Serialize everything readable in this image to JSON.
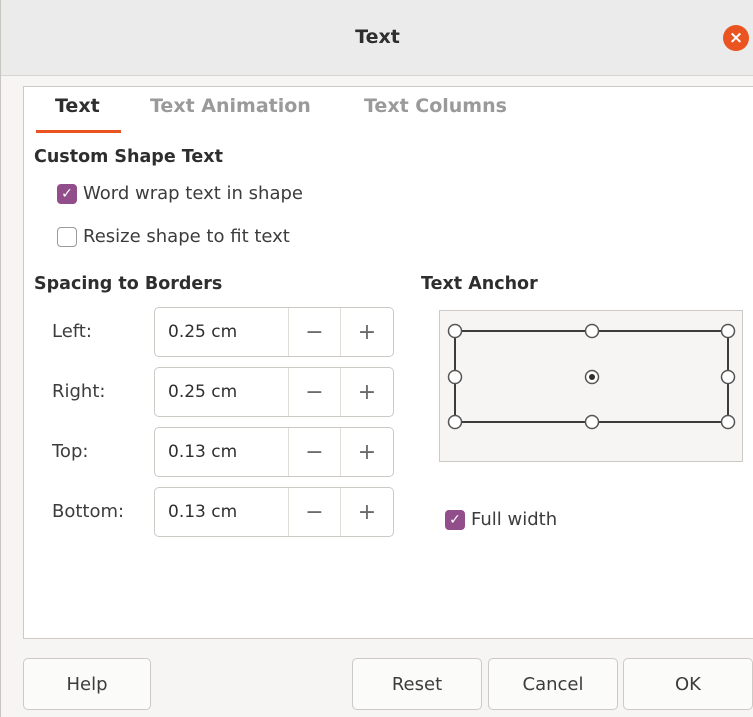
{
  "window": {
    "title": "Text",
    "close_glyph": "×"
  },
  "tabs": [
    {
      "label": "Text",
      "active": true
    },
    {
      "label": "Text Animation",
      "active": false
    },
    {
      "label": "Text Columns",
      "active": false
    }
  ],
  "custom_shape": {
    "heading": "Custom Shape Text",
    "word_wrap": {
      "label": "Word wrap text in shape",
      "checked": true
    },
    "resize": {
      "label": "Resize shape to fit text",
      "checked": false
    }
  },
  "spacing": {
    "heading": "Spacing to Borders",
    "fields": [
      {
        "label": "Left:",
        "value": "0.25 cm"
      },
      {
        "label": "Right:",
        "value": "0.25 cm"
      },
      {
        "label": "Top:",
        "value": "0.13 cm"
      },
      {
        "label": "Bottom:",
        "value": "0.13 cm"
      }
    ],
    "minus_glyph": "−",
    "plus_glyph": "+"
  },
  "anchor": {
    "heading": "Text Anchor",
    "selected": "center",
    "full_width": {
      "label": "Full width",
      "checked": true
    }
  },
  "buttons": {
    "help": "Help",
    "reset": "Reset",
    "cancel": "Cancel",
    "ok": "OK"
  },
  "colors": {
    "accent": "#e95420",
    "checkbox": "#924d8b"
  }
}
